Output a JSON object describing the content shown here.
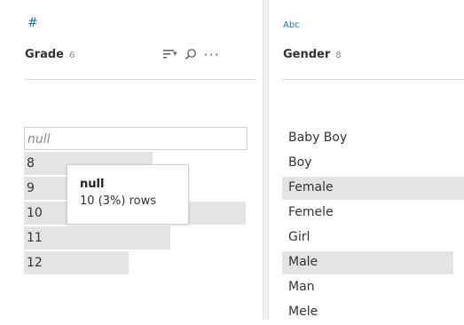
{
  "grade": {
    "type_icon": "#",
    "title": "Grade",
    "count": "6",
    "toolbar": {
      "sort_icon": "sort-icon",
      "search_icon": "search-icon",
      "more_icon": "more-icon"
    },
    "values": [
      {
        "label": "null",
        "share": 1.0
      },
      {
        "label": "8",
        "share": 0.58
      },
      {
        "label": "9",
        "share": 0.67
      },
      {
        "label": "10",
        "share": 1.0
      },
      {
        "label": "11",
        "share": 0.66
      },
      {
        "label": "12",
        "share": 0.47
      }
    ]
  },
  "tooltip": {
    "title": "null",
    "body": "10 (3%) rows"
  },
  "gender": {
    "type_icon": "Abc",
    "title": "Gender",
    "count": "8",
    "values": [
      {
        "label": "Baby Boy",
        "share": 0
      },
      {
        "label": "Boy",
        "share": 0
      },
      {
        "label": "Female",
        "share": 1.0
      },
      {
        "label": "Femele",
        "share": 0
      },
      {
        "label": "Girl",
        "share": 0
      },
      {
        "label": "Male",
        "share": 0.94
      },
      {
        "label": "Man",
        "share": 0
      },
      {
        "label": "Mele",
        "share": 0
      }
    ]
  },
  "colors": {
    "bar": "#e3e3e3",
    "type_icon": "#1f77b4"
  }
}
